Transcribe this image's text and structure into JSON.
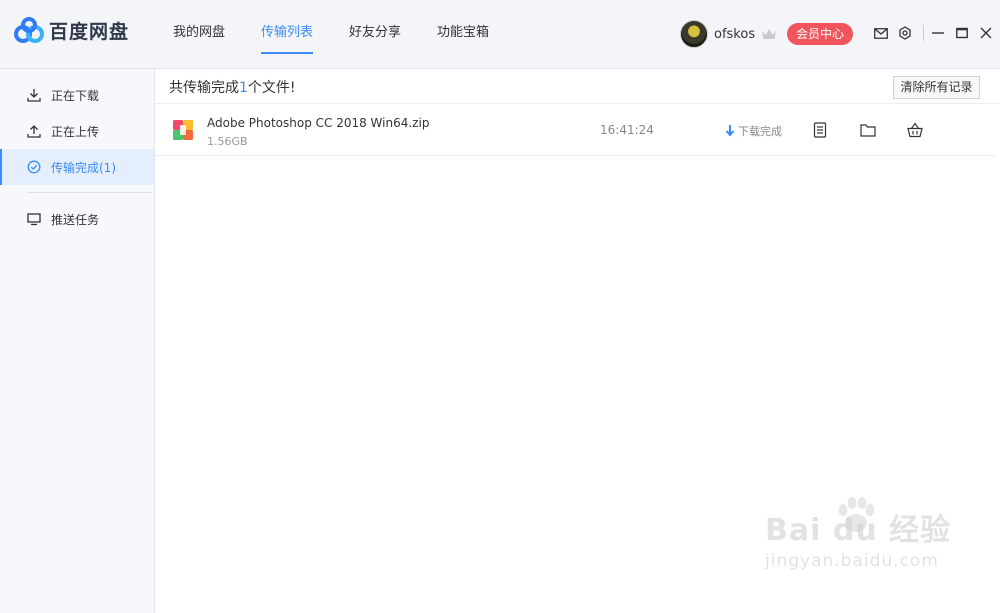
{
  "app": {
    "name": "百度网盘"
  },
  "nav": {
    "tabs": [
      {
        "label": "我的网盘"
      },
      {
        "label": "传输列表"
      },
      {
        "label": "好友分享"
      },
      {
        "label": "功能宝箱"
      }
    ],
    "active_index": 1
  },
  "user": {
    "name": "ofskos",
    "vip_button": "会员中心"
  },
  "sidebar": {
    "items": [
      {
        "label": "正在下载",
        "icon": "download-icon"
      },
      {
        "label": "正在上传",
        "icon": "upload-icon"
      },
      {
        "label": "传输完成(1)",
        "icon": "check-circle-icon"
      },
      {
        "label": "推送任务",
        "icon": "monitor-icon"
      }
    ],
    "active_index": 2
  },
  "main": {
    "summary_prefix": "共传输完成",
    "summary_count": "1",
    "summary_suffix": "个文件!",
    "clear_button": "清除所有记录",
    "files": [
      {
        "name": "Adobe Photoshop CC 2018 Win64.zip",
        "size": "1.56GB",
        "time": "16:41:24",
        "status": "下载完成"
      }
    ]
  },
  "watermark": {
    "brand": "Bai du 经验",
    "url": "jingyan.baidu.com"
  },
  "colors": {
    "accent": "#3b8cf7",
    "vip": "#f2545b",
    "sidebar_active_bg": "#e4eefc"
  }
}
